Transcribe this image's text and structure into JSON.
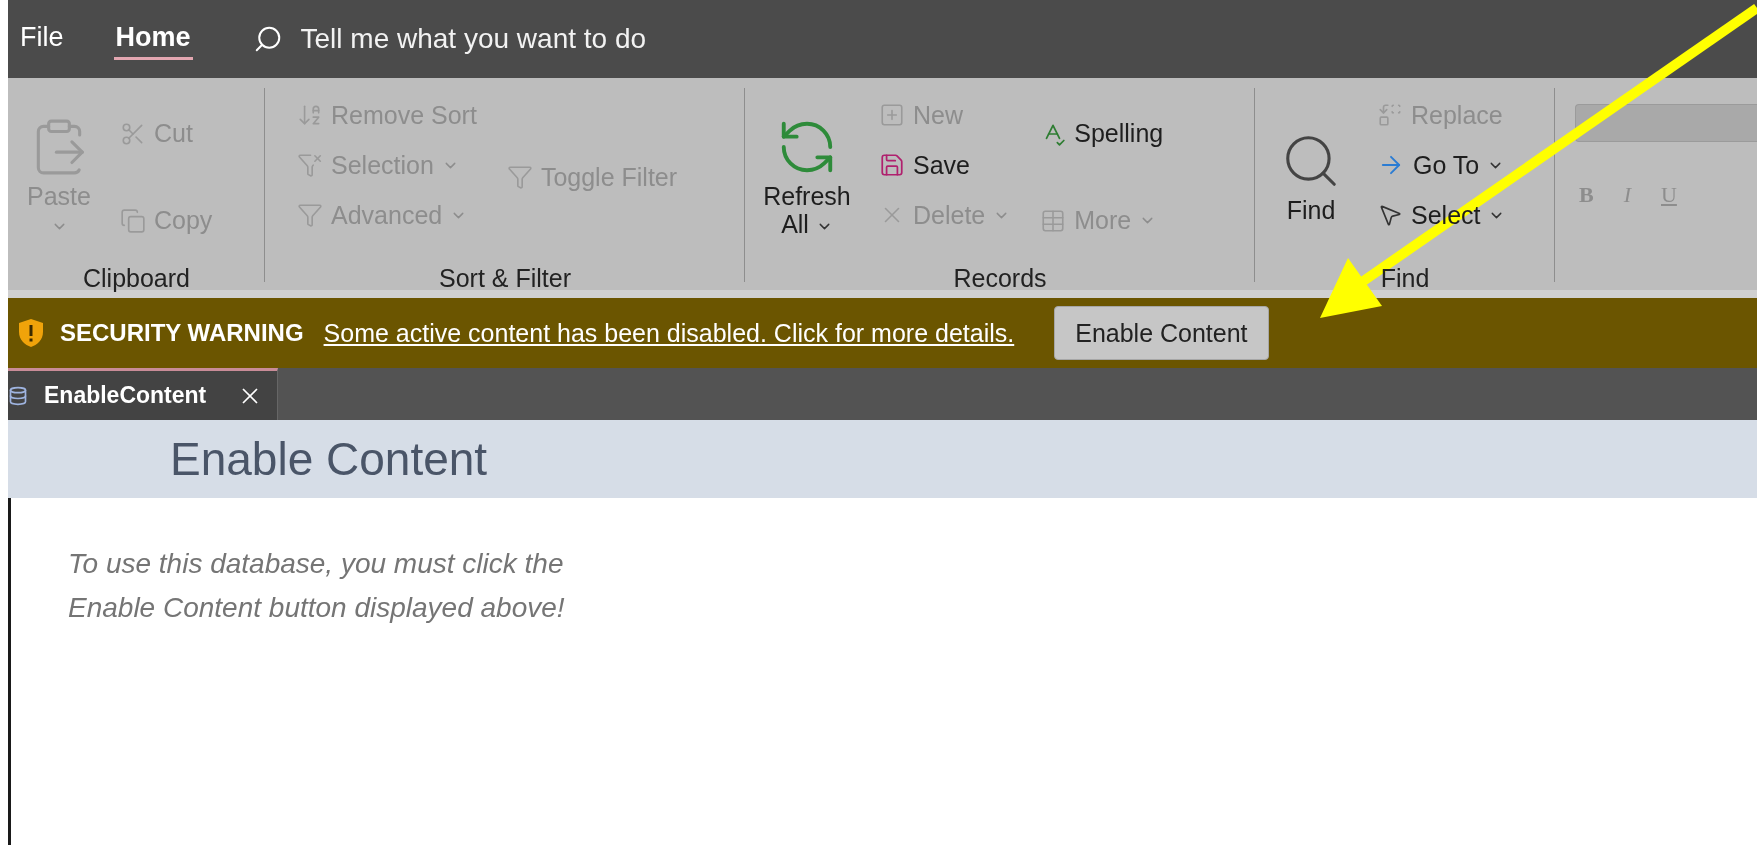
{
  "menu_tabs": [
    {
      "label": "File",
      "selected": false
    },
    {
      "label": "Home",
      "selected": true
    }
  ],
  "tell_me": {
    "placeholder": "Tell me what you want to do"
  },
  "ribbon": {
    "groups": [
      {
        "kind": "clipboard",
        "label": "Clipboard",
        "columns": [
          [
            {
              "label": "Paste",
              "disabled": true,
              "dropdown": true
            }
          ],
          [
            {
              "label": "Cut",
              "disabled": true
            },
            {
              "label": "Copy",
              "disabled": true
            }
          ]
        ]
      },
      {
        "kind": "sort_filter",
        "label": "Sort & Filter",
        "columns": [
          [
            {
              "label": "Remove Sort",
              "disabled": true
            },
            {
              "label": "Selection",
              "disabled": true,
              "dropdown": true
            },
            {
              "label": "Advanced",
              "disabled": true,
              "dropdown": true
            }
          ],
          [
            {
              "label": "Toggle Filter",
              "disabled": true
            }
          ]
        ]
      },
      {
        "kind": "records",
        "label": "Records",
        "columns": [
          [
            {
              "label": "Refresh All",
              "disabled": false,
              "dropdown": true
            }
          ],
          [
            {
              "label": "New",
              "disabled": true
            },
            {
              "label": "Save",
              "disabled": false
            },
            {
              "label": "Delete",
              "disabled": true,
              "dropdown": true
            }
          ],
          [
            {
              "label": "Spelling",
              "disabled": false
            },
            {
              "label": "More",
              "disabled": true,
              "dropdown": true
            }
          ]
        ]
      },
      {
        "kind": "find",
        "label": "Find",
        "columns": [
          [
            {
              "label": "Find",
              "disabled": false
            }
          ],
          [
            {
              "label": "Replace",
              "disabled": true
            },
            {
              "label": "Go To",
              "disabled": false,
              "dropdown": true
            },
            {
              "label": "Select",
              "disabled": false,
              "dropdown": true
            }
          ]
        ]
      },
      {
        "kind": "text_format",
        "columns": [
          [
            {
              "label": "B",
              "disabled": true
            },
            {
              "label": "I",
              "disabled": true
            },
            {
              "label": "U",
              "disabled": true
            }
          ]
        ]
      }
    ]
  },
  "security_bar": {
    "title": "SECURITY WARNING",
    "message": "Some active content has been disabled. Click for more details.",
    "button": "Enable Content"
  },
  "document_tabs": [
    {
      "label": "EnableContent",
      "selected": true
    }
  ],
  "form": {
    "title": "Enable Content",
    "lines": [
      "To use this database, you must click the",
      "Enable Content button displayed above!"
    ]
  }
}
